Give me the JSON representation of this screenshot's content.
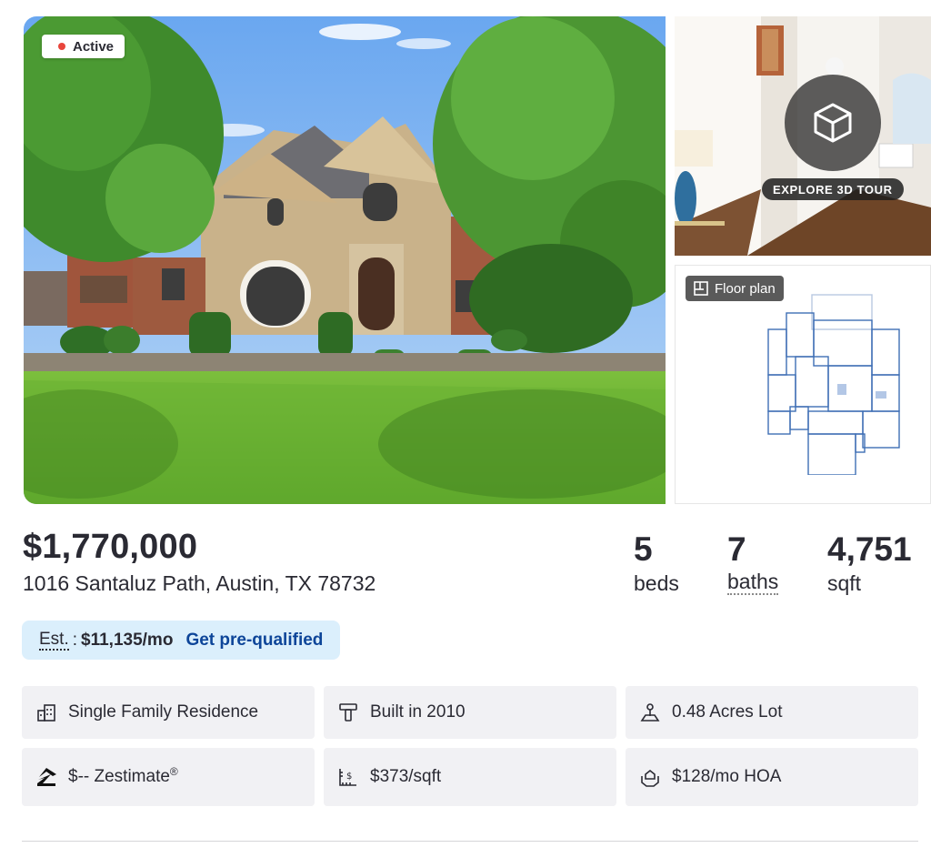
{
  "listing": {
    "status": "Active",
    "status_color": "#e8453c",
    "tour_label": "EXPLORE 3D TOUR",
    "floorplan_label": "Floor plan"
  },
  "summary": {
    "price": "$1,770,000",
    "address": "1016 Santaluz Path, Austin, TX 78732",
    "beds_value": "5",
    "beds_label": "beds",
    "baths_value": "7",
    "baths_label": "baths",
    "sqft_value": "4,751",
    "sqft_label": "sqft"
  },
  "payment": {
    "est_label": "Est.",
    "est_separator": ":",
    "est_value": "$11,135/mo",
    "cta": "Get pre-qualified",
    "bg_color": "#dbeffc",
    "cta_color": "#0d4599"
  },
  "facts": {
    "type": "Single Family Residence",
    "built": "Built in 2010",
    "lot": "0.48 Acres Lot",
    "zestimate": "$-- Zestimate",
    "zestimate_mark": "®",
    "price_per_sqft": "$373/sqft",
    "hoa": "$128/mo HOA",
    "icons": [
      "building-icon",
      "hammer-icon",
      "lot-icon",
      "zillow-logo-icon",
      "ruler-dollar-icon",
      "hoa-hands-icon"
    ]
  }
}
